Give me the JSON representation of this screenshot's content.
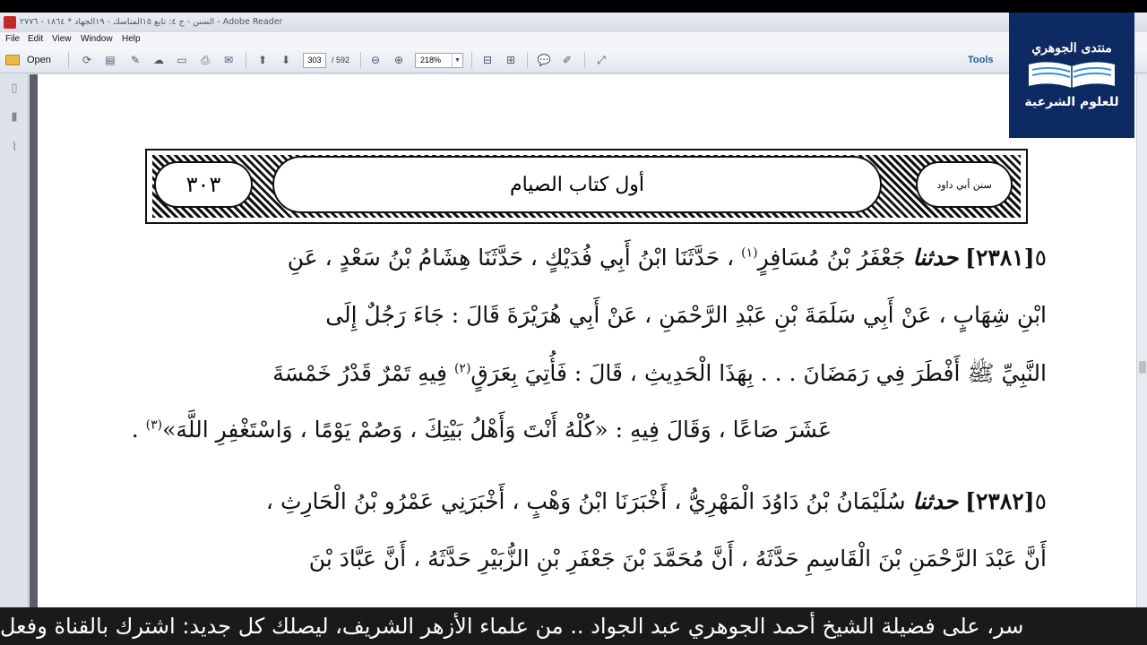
{
  "window": {
    "title": "السنن - ج ٤: تابع ١٥المناسك - ١٩الجهاد * ١٨٦٤ - ٢٧٧٦ - Adobe Reader"
  },
  "menu": [
    "File",
    "Edit",
    "View",
    "Window",
    "Help"
  ],
  "toolbar": {
    "open_label": "Open",
    "current_page": "303",
    "total_pages": "/ 592",
    "zoom": "218%",
    "tools_label": "Tools"
  },
  "header": {
    "page_number": "٣٠٣",
    "chapter_title": "أول كتاب الصيام",
    "book_name": "سنن أبي داود"
  },
  "text": {
    "hadith1": {
      "num": "[٢٣٨١]",
      "line1_lead": "حدثنا",
      "line1": "جَعْفَرُ بْنُ مُسَافِرٍ",
      "fn1": "(١)",
      "line1_rest": "، حَدَّثَنَا ابْنُ أَبِي فُدَيْكٍ ، حَدَّثَنَا هِشَامُ بْنُ سَعْدٍ ، عَنِ",
      "line2": "ابْنِ شِهَابٍ ، عَنْ أَبِي سَلَمَةَ بْنِ عَبْدِ الرَّحْمَنِ ، عَنْ أَبِي هُرَيْرَةَ قَالَ : جَاءَ رَجُلٌ إِلَى",
      "line3": "النَّبِيِّ ﷺ أَفْطَرَ فِي رَمَضَانَ . . . بِهَذَا الْحَدِيثِ ، قَالَ : فَأُتِيَ بِعَرَقٍ",
      "fn2": "(٢)",
      "line3_rest": "فِيهِ تَمْرٌ قَدْرُ خَمْسَةَ",
      "line4": "عَشَرَ صَاعًا ، وَقَالَ فِيهِ : «كُلْهُ أَنْتَ وَأَهْلُ بَيْتِكَ ، وَصُمْ يَوْمًا ، وَاسْتَغْفِرِ اللَّهَ»",
      "fn3": "(٣)"
    },
    "hadith2": {
      "num": "[٢٣٨٢]",
      "line1_lead": "حدثنا",
      "line1": "سُلَيْمَانُ بْنُ دَاوُدَ الْمَهْرِيُّ ، أَخْبَرَنَا ابْنُ وَهْبٍ ، أَخْبَرَنِي عَمْرُو بْنُ الْحَارِثِ ،",
      "line2": "أَنَّ عَبْدَ الرَّحْمَنِ بْنَ الْقَاسِمِ حَدَّثَهُ ، أَنَّ مُحَمَّدَ بْنَ جَعْفَرِ بْنِ الزُّبَيْرِ حَدَّثَهُ ، أَنَّ عَبَّادَ بْنَ"
    }
  },
  "logo": {
    "top_text": "منتدى الجوهري",
    "bottom_text": "للعلوم الشرعية"
  },
  "ticker": {
    "text": "سر، على فضيلة الشيخ أحمد الجوهري عبد الجواد .. من علماء الأزهر الشريف، ليصلك كل جديد: اشترك بالقناة وفعل"
  },
  "colors": {
    "logo_bg": "#0e2a63",
    "tools_accent": "#2c5c99",
    "ticker_bg": "#1a1a1a"
  }
}
